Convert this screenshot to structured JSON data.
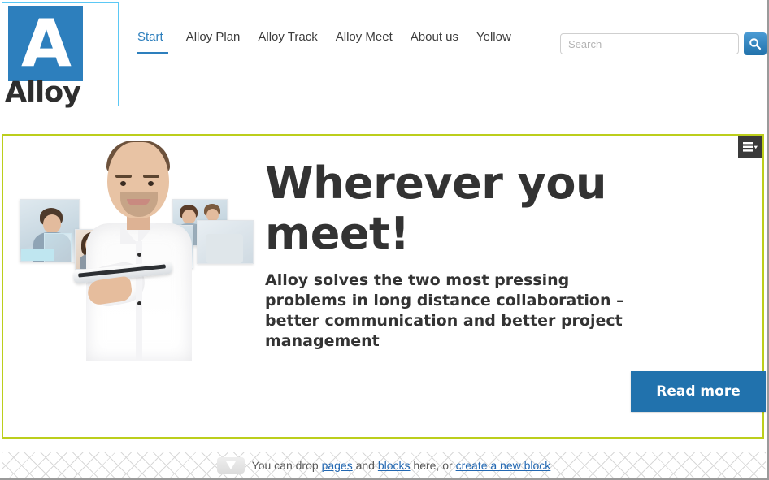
{
  "brand": {
    "logo_letter": "A",
    "logo_wordmark": "Alloy",
    "logo_icon": "alloy-logo-icon",
    "accent_blue": "#2d7fbd",
    "logo_border_blue": "#5bc8f5",
    "block_border_olive": "#bcce1c",
    "link_blue": "#2368b2"
  },
  "nav": {
    "items": [
      {
        "label": "Start",
        "active": true
      },
      {
        "label": "Alloy Plan",
        "active": false
      },
      {
        "label": "Alloy Track",
        "active": false
      },
      {
        "label": "Alloy Meet",
        "active": false
      },
      {
        "label": "About us",
        "active": false
      },
      {
        "label": "Yellow",
        "active": false
      }
    ]
  },
  "search": {
    "value": "",
    "placeholder": "Search",
    "button_icon": "search-icon"
  },
  "hero": {
    "menu_icon": "hamburger-menu-icon",
    "image_alt": "man-holding-tablet-with-video-call-thumbnails",
    "heading": "Wherever you meet!",
    "paragraph": "Alloy solves the two most pressing problems in long distance collaboration – better communication and better project management",
    "cta_label": "Read more"
  },
  "drop_zone": {
    "icon": "drop-arrow-icon",
    "text_before": "You can drop ",
    "link_pages": "pages",
    "text_middle": " and ",
    "link_blocks": "blocks",
    "text_after": " here, or ",
    "link_create": "create a new block"
  }
}
